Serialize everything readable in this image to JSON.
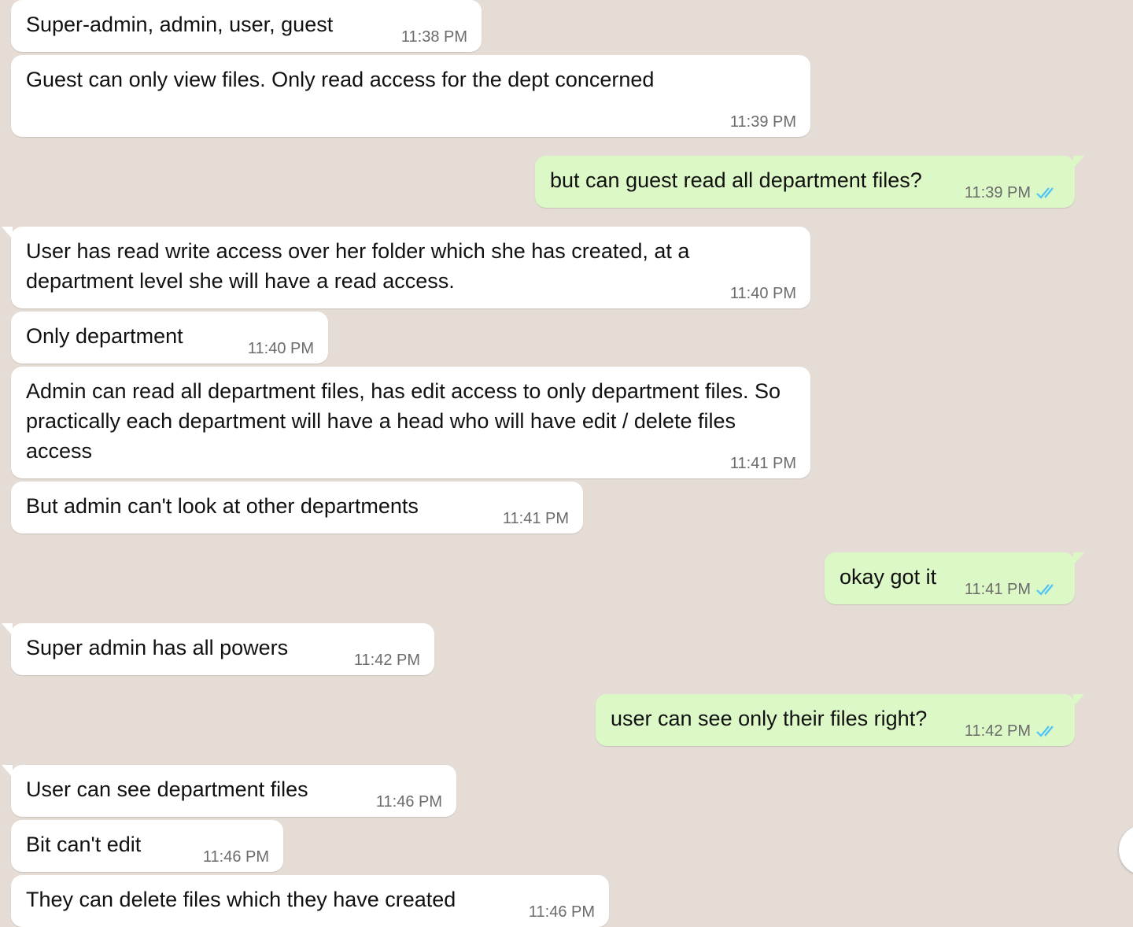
{
  "messages": [
    {
      "dir": "in",
      "text": "Super-admin, admin, user, guest",
      "time": "11:38 PM"
    },
    {
      "dir": "in",
      "text": "Guest can only view files. Only read access for the dept concerned",
      "time": "11:39 PM"
    },
    {
      "dir": "out",
      "text": "but can guest read all department files?",
      "time": "11:39 PM",
      "status": "read-double-check-icon"
    },
    {
      "dir": "in",
      "text": "User has read write access over her folder which she has created, at a department level she will have a read access.",
      "time": "11:40 PM"
    },
    {
      "dir": "in",
      "text": "Only department",
      "time": "11:40 PM"
    },
    {
      "dir": "in",
      "text": "Admin can read all department files, has edit access to only department files. So practically each department will have a head who will have edit / delete files access",
      "time": "11:41 PM"
    },
    {
      "dir": "in",
      "text": "But admin can't look at other departments",
      "time": "11:41 PM"
    },
    {
      "dir": "out",
      "text": "okay got it",
      "time": "11:41 PM",
      "status": "read-double-check-icon"
    },
    {
      "dir": "in",
      "text": "Super admin has all powers",
      "time": "11:42 PM"
    },
    {
      "dir": "out",
      "text": "user can see only their files right?",
      "time": "11:42 PM",
      "status": "read-double-check-icon"
    },
    {
      "dir": "in",
      "text": "User can see department files",
      "time": "11:46 PM"
    },
    {
      "dir": "in",
      "text": "Bit can't edit",
      "time": "11:46 PM"
    },
    {
      "dir": "in",
      "text": "They can delete files which they have created",
      "time": "11:46 PM"
    }
  ],
  "colors": {
    "incoming": "#ffffff",
    "outgoing": "#dcf8c6",
    "background": "#e5ddd5",
    "read_tick": "#4fc3f7"
  },
  "scroll_button_icon": "scroll-down-icon"
}
